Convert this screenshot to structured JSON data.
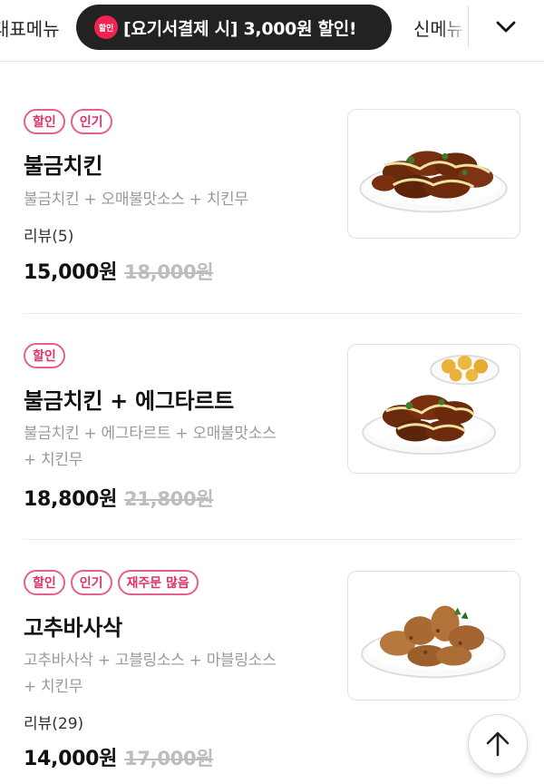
{
  "category_bar": {
    "left_label": "대표메뉴",
    "promo_badge": "할인",
    "promo_text": "[요기서결제 시] 3,000원 할인!",
    "right_label": "신메뉴",
    "expand_icon": "chevron-down-icon"
  },
  "menu_items": [
    {
      "badges": [
        "할인",
        "인기"
      ],
      "name": "불금치킨",
      "description_lines": [
        "불금치킨 + 오매불맛소스 + 치킨무"
      ],
      "review": "리뷰(5)",
      "price": "15,000원",
      "original_price": "18,000원"
    },
    {
      "badges": [
        "할인"
      ],
      "name": "불금치킨 + 에그타르트",
      "description_lines": [
        "불금치킨 + 에그타르트 + 오매불맛소스",
        "+ 치킨무"
      ],
      "price": "18,800원",
      "original_price": "21,800원"
    },
    {
      "badges": [
        "할인",
        "인기",
        "재주문 많음"
      ],
      "name": "고추바사삭",
      "description_lines": [
        "고추바사삭 + 고블링소스 + 마블링소스",
        "+ 치킨무"
      ],
      "review": "리뷰(29)",
      "price": "14,000원",
      "original_price": "17,000원"
    }
  ],
  "scroll_top_icon": "arrow-up-icon",
  "colors": {
    "accent": "#e0306c",
    "promo_bg": "#222222",
    "promo_badge_bg": "#f0224f",
    "muted_text": "#9a9a9a",
    "strike_price": "#bdbdbd"
  }
}
